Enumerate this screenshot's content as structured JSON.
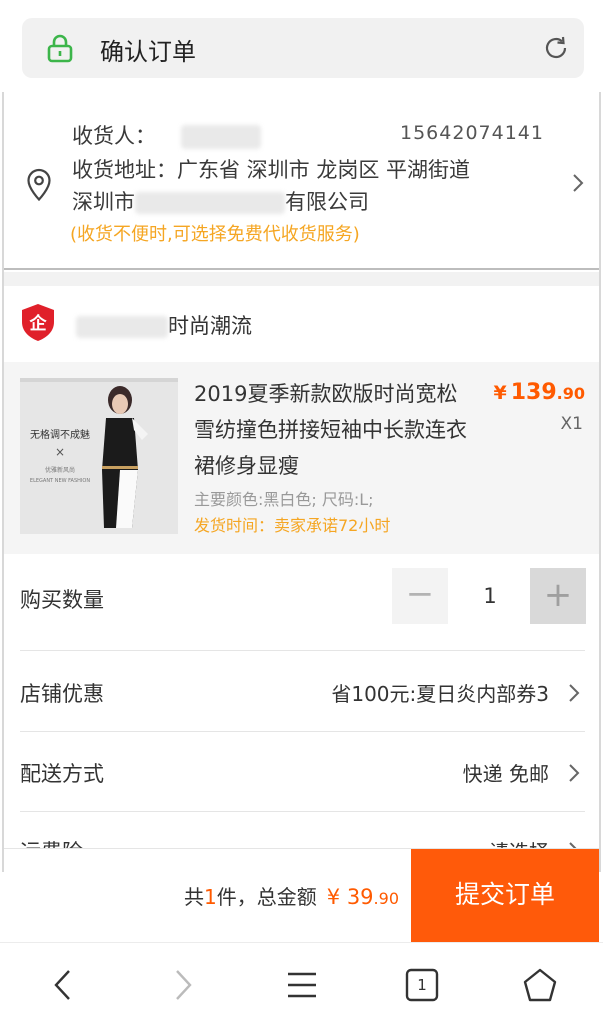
{
  "browser": {
    "title": "确认订单",
    "icons": {
      "lock": "lock-icon",
      "reload": "reload-icon"
    }
  },
  "address": {
    "recipient_label": "收货人：",
    "phone": "15642074141",
    "address_line1": "收货地址：广东省 深圳市 龙岗区 平湖街道",
    "address_line2_start": "深圳市",
    "address_line2_end": "有限公司",
    "note": "(收货不便时,可选择免费代收货服务)"
  },
  "shop": {
    "name_suffix": "时尚潮流",
    "logo_text": "企"
  },
  "product": {
    "title": "2019夏季新款欧版时尚宽松雪纺撞色拼接短袖中长款连衣裙修身显瘦",
    "spec": "主要颜色:黑白色; 尺码:L;",
    "shipping": "发货时间：卖家承诺72小时",
    "price_symbol": "¥",
    "price_int": "139",
    "price_dec": ".90",
    "quantity_text": "X1",
    "image_text_1": "无格调不成魅",
    "image_text_2": "×",
    "image_text_3": "优雅新风尚",
    "image_text_4": "ELEGANT NEW FASHION"
  },
  "quantity": {
    "label": "购买数量",
    "value": "1",
    "minus": "−",
    "plus": "+"
  },
  "discount": {
    "label": "店铺优惠",
    "value": "省100元:夏日炎内部券3"
  },
  "delivery": {
    "label": "配送方式",
    "value": "快递 免邮"
  },
  "insurance": {
    "label": "运费险",
    "value": "请选择"
  },
  "summary": {
    "prefix": "共",
    "count": "1",
    "middle": "件，总金额",
    "symbol": "¥",
    "amount_int": "39",
    "amount_dec": ".90",
    "submit_label": "提交订单"
  },
  "navbar": {
    "tab_count": "1",
    "icons": [
      "back-icon",
      "forward-icon",
      "menu-icon",
      "tabs-icon",
      "home-icon"
    ]
  },
  "colors": {
    "accent": "#ff5a0a",
    "price": "#ff5a00",
    "note": "#f5a623",
    "lock_green": "#3cb54a",
    "shop_red": "#e0202a"
  }
}
